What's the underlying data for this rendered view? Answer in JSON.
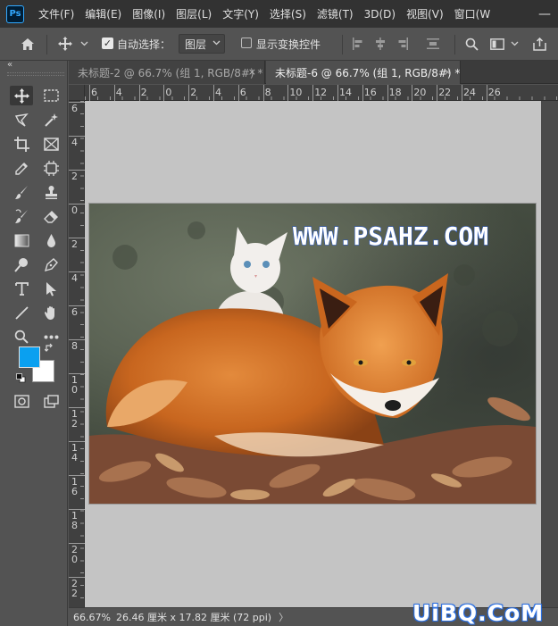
{
  "app": {
    "logo_text": "Ps"
  },
  "menu": {
    "items": [
      "文件(F)",
      "编辑(E)",
      "图像(I)",
      "图层(L)",
      "文字(Y)",
      "选择(S)",
      "滤镜(T)",
      "3D(D)",
      "视图(V)",
      "窗口(W"
    ],
    "minimize_glyph": "—"
  },
  "options_bar": {
    "auto_select_label": "自动选择：",
    "auto_select_checked": true,
    "target_value": "图层",
    "show_transform_label": "显示变换控件",
    "show_transform_checked": false
  },
  "tools": {
    "icons": [
      "move-tool-icon",
      "marquee-tool-icon",
      "lasso-tool-icon",
      "quick-select-tool-icon",
      "crop-tool-icon",
      "frame-tool-icon",
      "eyedropper-tool-icon",
      "spot-heal-tool-icon",
      "brush-tool-icon",
      "stamp-tool-icon",
      "history-brush-tool-icon",
      "eraser-tool-icon",
      "gradient-tool-icon",
      "blur-tool-icon",
      "dodge-tool-icon",
      "pen-tool-icon",
      "type-tool-icon",
      "path-select-tool-icon",
      "line-tool-icon",
      "hand-tool-icon",
      "zoom-tool-icon",
      "more-tools-icon",
      "quick-mask-icon",
      "screen-mode-icon"
    ],
    "collapse_glyph": "«",
    "foreground_color": "#0aa0f0",
    "background_color": "#ffffff"
  },
  "tabs": [
    {
      "label": "未标题-2 @ 66.7% (组 1, RGB/8#) *",
      "close": "×"
    },
    {
      "label": "未标题-6 @ 66.7% (组 1, RGB/8#) *",
      "close": "×",
      "active": true
    }
  ],
  "rulers": {
    "top_labels": [
      "6",
      "4",
      "2",
      "0",
      "2",
      "4",
      "6",
      "8",
      "10",
      "12",
      "14",
      "16",
      "18",
      "20",
      "22",
      "24",
      "26"
    ],
    "left_labels": [
      "6",
      "4",
      "2",
      "0",
      "2",
      "4",
      "6",
      "8",
      "10",
      "12",
      "14",
      "16",
      "18",
      "20",
      "22"
    ]
  },
  "document": {
    "watermark_text": "WWW.PSAHZ.COM"
  },
  "status": {
    "zoom": "66.67%",
    "doc_size": "26.46 厘米 x 17.82 厘米 (72 ppi)",
    "arrow": "〉"
  },
  "site_watermark": "UiBQ.CoM"
}
